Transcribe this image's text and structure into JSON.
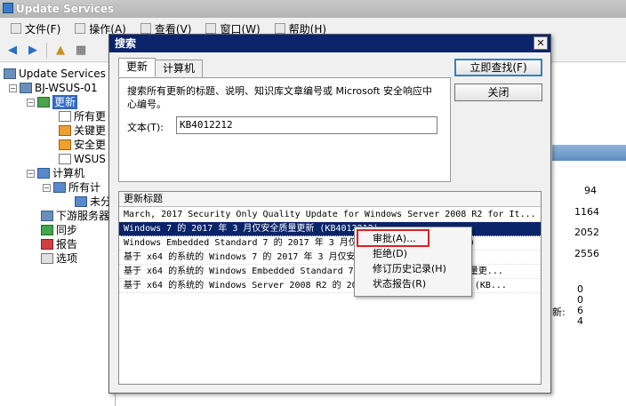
{
  "window": {
    "title": "Update Services"
  },
  "menu": [
    "文件(F)",
    "操作(A)",
    "查看(V)",
    "窗口(W)",
    "帮助(H)"
  ],
  "tree": {
    "root": "Update Services",
    "server": "BJ-WSUS-01",
    "updates": "更新",
    "updates_children": [
      "所有更",
      "关键更",
      "安全更",
      "WSUS 更"
    ],
    "computers": "计算机",
    "computers_all": "所有计",
    "unassigned": "未分",
    "downstream": "下游服务器",
    "sync": "同步",
    "reports": "报告",
    "options": "选项"
  },
  "right_pane": {
    "numbers": [
      "94",
      "1164",
      "2052",
      "2556",
      "0",
      "0",
      "6",
      "4"
    ],
    "label": "新:"
  },
  "dialog": {
    "title": "搜索",
    "close_glyph": "✕",
    "tabs": [
      "更新",
      "计算机"
    ],
    "description": "搜索所有更新的标题、说明、知识库文章编号或 Microsoft 安全响应中心编号。",
    "text_label": "文本(T):",
    "text_value": "KB4012212",
    "find_now": "立即查找(F)",
    "close": "关闭",
    "results_header": "更新标题",
    "results": [
      "March, 2017 Security Only Quality Update for Windows Server 2008 R2 for It...",
      "Windows 7 的 2017 年 3 月仅安全质量更新 (KB4012212)",
      "Windows Embedded Standard 7 的 2017 年 3 月仅安全质量更新 (KB4012212)",
      "基于 x64 的系统的 Windows 7 的 2017 年 3 月仅安全质量更新 (KB4012212)",
      "基于 x64 的系统的 Windows Embedded Standard 7 的 2017 年 3 月仅安全质量更...",
      "基于 x64 的系统的 Windows Server 2008 R2 的 2017 年 3 月仅安全质量更新 (KB..."
    ]
  },
  "context_menu": [
    "审批(A)...",
    "拒绝(D)",
    "修订历史记录(H)",
    "状态报告(R)"
  ]
}
